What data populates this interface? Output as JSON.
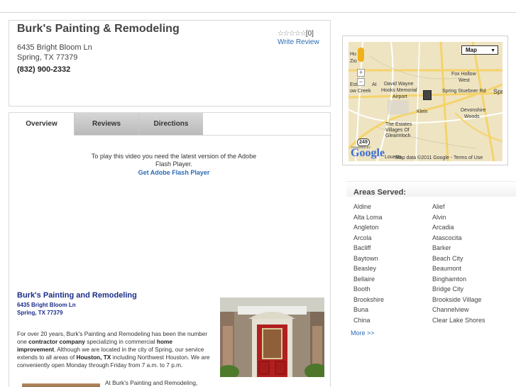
{
  "business": {
    "name": "Burk's Painting & Remodeling",
    "address_line1": "6435 Bright Bloom Ln",
    "address_line2": "Spring, TX 77379",
    "phone": "(832) 900-2332",
    "rating_stars": "☆☆☆☆☆",
    "rating_count": "[0]",
    "write_review": "Write Review"
  },
  "tabs": [
    {
      "label": "Overview",
      "active": true
    },
    {
      "label": "Reviews",
      "active": false
    },
    {
      "label": "Directions",
      "active": false
    }
  ],
  "flash": {
    "message": "To play this video you need the latest version of the Adobe Flash Player.",
    "link": "Get Adobe Flash Player"
  },
  "description": {
    "title": "Burk's Painting and Remodeling",
    "addr1": "6435 Bright Bloom Ln",
    "addr2": "Spring, TX 77379",
    "p1_a": "For over 20 years, Burk's Painting and Remodeling has been the number one ",
    "p1_b": "contractor company",
    "p1_c": " specializing in commercial ",
    "p1_d": "home improvement",
    "p1_e": ". Although we are located in the city of Spring, our service extends to all areas of ",
    "p1_f": "Houston, TX",
    "p1_g": " including Northwest Houston.  We are conveniently open Monday through Friday from 7 a.m. to 7 p.m.",
    "p2": "At Burk's Painting and Remodeling,"
  },
  "map": {
    "type_selector": "Map",
    "zoom_in": "+",
    "zoom_out": "−",
    "labels": {
      "hu": "Hu",
      "zio": "Zio",
      "est": "Est",
      "at": "At",
      "crk": "ow Creek",
      "david": "David Wayne",
      "hooks": "Hooks Memorial",
      "airport": "Airport",
      "foxhollow": "Fox Hollow",
      "west": "West",
      "stuebner": "Spring Stuebner Rd",
      "spr": "Spr",
      "klein": "Klein",
      "devonshire": "Devonshire",
      "woods": "Woods",
      "estates": "The Estates",
      "villages": "Villages Of",
      "gleannloch": "Gleannloch",
      "louetta": "Louetta",
      "route": "249"
    },
    "powered_by": "POWERED BY",
    "logo": "Google",
    "attribution": "Map data ©2011 Google - Terms of Use"
  },
  "areas": {
    "title": "Areas Served:",
    "left": [
      "Aldine",
      "Alta Loma",
      "Angleton",
      "Arcola",
      "Bacliff",
      "Baytown",
      "Beasley",
      "Bellaire",
      "Booth",
      "Brookshire",
      "Buna",
      "China"
    ],
    "right": [
      "Alief",
      "Alvin",
      "Arcadia",
      "Atascocita",
      "Barker",
      "Beach City",
      "Beaumont",
      "Binghamton",
      "Bridge City",
      "Brookside Village",
      "Channelview",
      "Clear Lake Shores"
    ],
    "more": "More >>"
  }
}
